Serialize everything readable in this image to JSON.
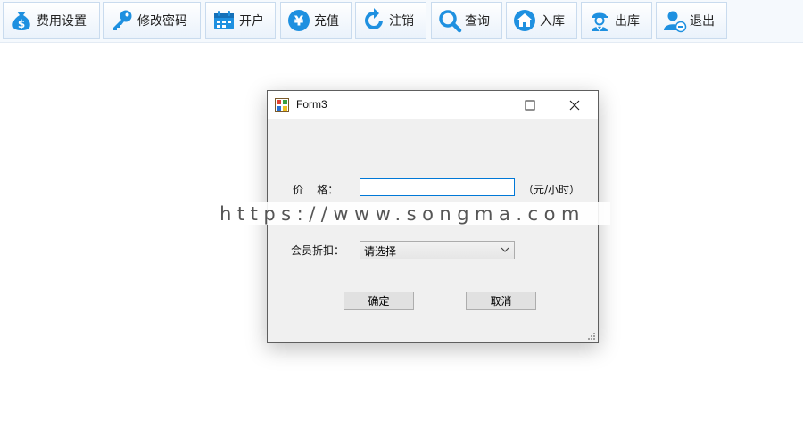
{
  "toolbar": {
    "buttons": [
      {
        "label": "费用设置",
        "icon": "money-bag-icon"
      },
      {
        "label": "修改密码",
        "icon": "key-icon"
      },
      {
        "label": "开户",
        "icon": "calendar-icon"
      },
      {
        "label": "充值",
        "icon": "yen-icon"
      },
      {
        "label": "注销",
        "icon": "refresh-icon"
      },
      {
        "label": "查询",
        "icon": "search-icon"
      },
      {
        "label": "入库",
        "icon": "home-icon"
      },
      {
        "label": "出库",
        "icon": "worker-icon"
      },
      {
        "label": "退出",
        "icon": "user-exit-icon"
      }
    ],
    "icon_color": "#1e90e0"
  },
  "dialog": {
    "title": "Form3",
    "price_label": "价    格：",
    "price_value": "",
    "price_unit": "（元/小时）",
    "discount_label": "会员折扣：",
    "discount_selected": "请选择",
    "ok_label": "确定",
    "cancel_label": "取消"
  },
  "watermark": {
    "text": "https://www.songma.com"
  }
}
